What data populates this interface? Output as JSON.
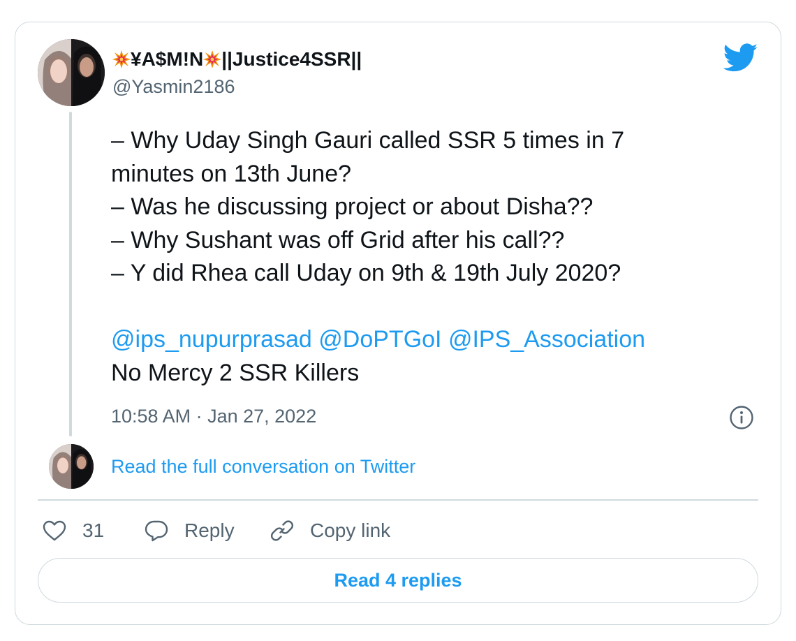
{
  "tweet": {
    "display_name": "¥A$M!N",
    "display_name_suffix": "||Justice4SSR||",
    "name_emoji_icon": "collision-burst-icon",
    "handle": "@Yasmin2186",
    "lines": [
      "– Why Uday Singh Gauri called SSR 5 times in 7",
      "minutes on 13th June?",
      "– Was he discussing project or about Disha??",
      "– Why Sushant was off Grid after his call??",
      "– Y did Rhea call Uday on 9th & 19th July 2020?"
    ],
    "mentions": [
      "@ips_nupurprasad",
      "@DoPTGoI",
      "@IPS_Association"
    ],
    "closing_line": "No Mercy 2 SSR Killers",
    "timestamp": "10:58 AM · Jan 27, 2022",
    "read_conversation": "Read the full conversation on Twitter"
  },
  "actions": {
    "like_count": "31",
    "reply_label": "Reply",
    "copy_label": "Copy link",
    "read_replies_label": "Read 4 replies"
  },
  "icons": {
    "brand": "twitter-bird-icon",
    "info": "info-icon",
    "like": "heart-icon",
    "reply": "speech-bubble-icon",
    "copy": "link-icon"
  },
  "colors": {
    "accent": "#1d9bf0",
    "text": "#0f1419",
    "muted": "#536471",
    "border": "#cfd9de"
  }
}
